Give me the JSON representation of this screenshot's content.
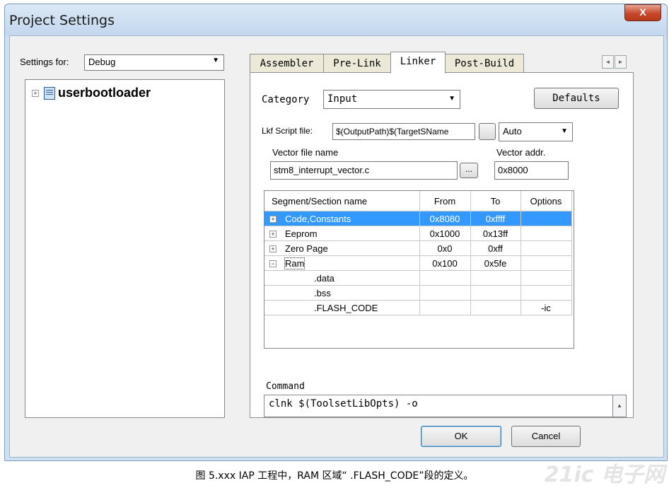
{
  "window": {
    "title": "Project Settings",
    "close_label": "X"
  },
  "settings_for": {
    "label": "Settings for:",
    "value": "Debug"
  },
  "tree": {
    "project_name": "userbootloader",
    "expander": "+"
  },
  "tabs": [
    {
      "label": "Assembler"
    },
    {
      "label": "Pre-Link"
    },
    {
      "label": "Linker"
    },
    {
      "label": "Post-Build"
    }
  ],
  "tab_scroll": {
    "left": "◄",
    "right": "►"
  },
  "linker": {
    "category_label": "Category",
    "category_value": "Input",
    "defaults_label": "Defaults",
    "lkf_label": "Lkf Script file:",
    "lkf_value": "$(OutputPath)$(TargetSName",
    "lkf_mode": "Auto",
    "vector_file_label": "Vector file name",
    "vector_file_value": "stm8_interrupt_vector.c",
    "browse_label": "...",
    "vector_addr_label": "Vector addr.",
    "vector_addr_value": "0x8000"
  },
  "segments": {
    "headers": {
      "name": "Segment/Section name",
      "from": "From",
      "to": "To",
      "options": "Options"
    },
    "rows": [
      {
        "expander": "+",
        "name": "Code,Constants",
        "from": "0x8080",
        "to": "0xffff",
        "options": ""
      },
      {
        "expander": "+",
        "name": "Eeprom",
        "from": "0x1000",
        "to": "0x13ff",
        "options": ""
      },
      {
        "expander": "+",
        "name": "Zero Page",
        "from": "0x0",
        "to": "0xff",
        "options": ""
      },
      {
        "expander": "−",
        "name": "Ram",
        "from": "0x100",
        "to": "0x5fe",
        "options": ""
      },
      {
        "expander": "",
        "name": ".data",
        "from": "",
        "to": "",
        "options": ""
      },
      {
        "expander": "",
        "name": ".bss",
        "from": "",
        "to": "",
        "options": ""
      },
      {
        "expander": "",
        "name": ".FLASH_CODE",
        "from": "",
        "to": "",
        "options": "-ic"
      }
    ]
  },
  "command": {
    "label": "Command",
    "text": "clnk $(ToolsetLibOpts) -o"
  },
  "buttons": {
    "ok": "OK",
    "cancel": "Cancel"
  },
  "caption": "图 5.xxx IAP 工程中，RAM 区域“ .FLASH_CODE”段的定义。",
  "watermark": "21ic 电子网",
  "colors": {
    "selection": "#3399ff",
    "title_bar": "#c3d7ee",
    "close_button": "#c6492c"
  }
}
